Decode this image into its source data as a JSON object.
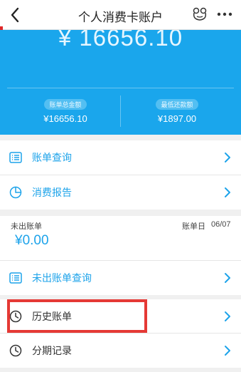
{
  "navbar": {
    "title": "个人消费卡账户",
    "back_icon": "chevron-left-icon",
    "frog_icon": "frog-icon",
    "more_icon": "more-dots-icon"
  },
  "hero": {
    "amount": "¥ 16656.10",
    "bill_total_label": "账单总金额",
    "bill_total_value": "¥16656.10",
    "min_payment_label": "最低还款额",
    "min_payment_value": "¥1897.00"
  },
  "menu": {
    "bill_query": "账单查询",
    "consumption_report": "消费报告"
  },
  "unbilled": {
    "title": "未出账单",
    "bill_day_label": "账单日",
    "bill_day": "06/07",
    "amount": "¥0.00",
    "query_label": "未出账单查询"
  },
  "history": {
    "history_bill": "历史账单",
    "installment_records": "分期记录"
  },
  "colors": {
    "primary_blue": "#1aa6ec",
    "link_blue": "#1da3ea",
    "highlight_red": "#e53935"
  }
}
